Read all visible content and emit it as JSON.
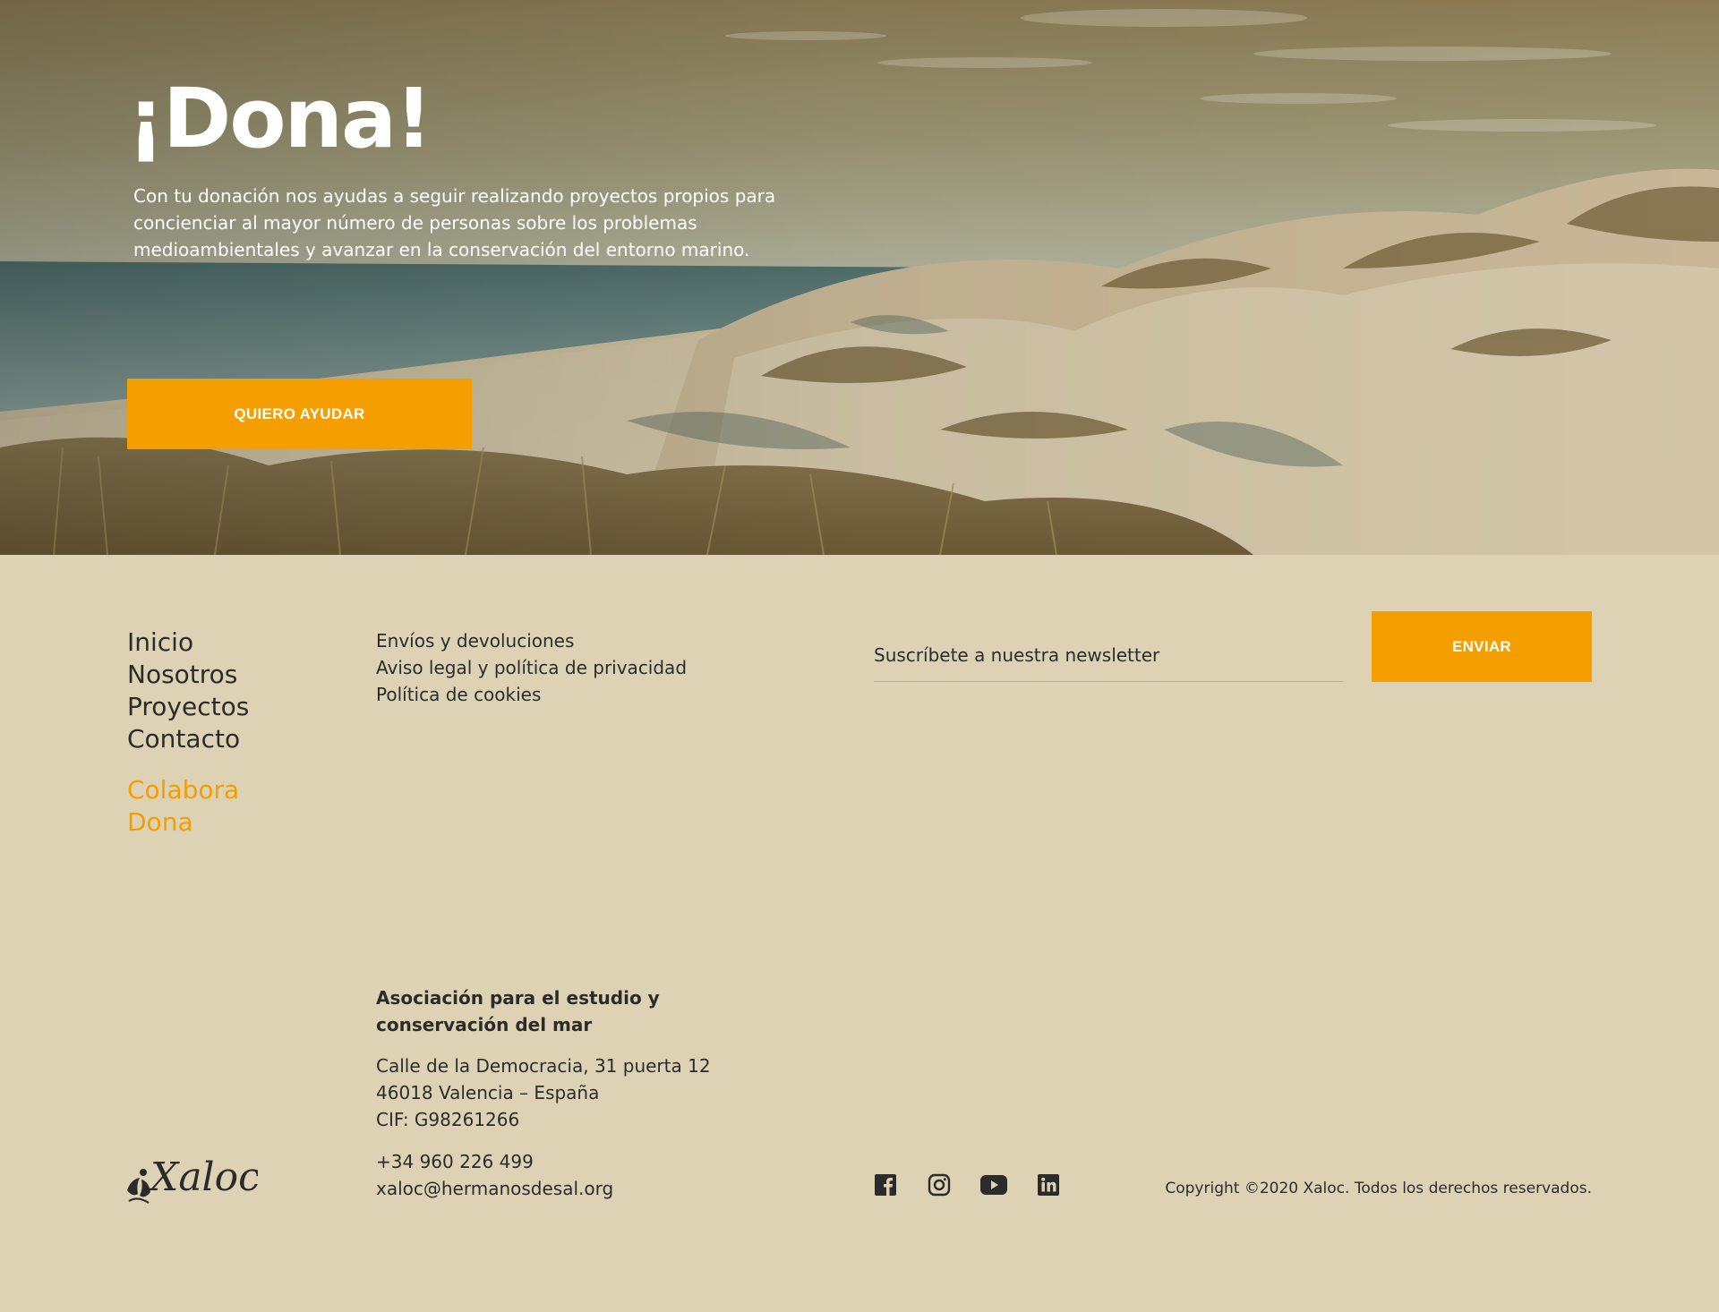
{
  "hero": {
    "title": "¡Dona!",
    "text": "Con tu donación nos ayudas a seguir realizando proyectos propios para concienciar al mayor número de personas sobre los problemas medioambientales y avanzar en la conservación del entorno marino.",
    "cta_label": "QUIERO AYUDAR"
  },
  "footer": {
    "nav_main": [
      "Inicio",
      "Nosotros",
      "Proyectos",
      "Contacto"
    ],
    "nav_accent": [
      "Colabora",
      "Dona"
    ],
    "nav_legal": [
      "Envíos y devoluciones",
      "Aviso legal y política de privacidad",
      "Política de cookies"
    ],
    "newsletter": {
      "placeholder": "Suscríbete a nuestra newsletter",
      "button_label": "ENVIAR"
    },
    "org": {
      "name": "Asociación para el estudio y conservación del mar",
      "address_line1": "Calle de la Democracia, 31 puerta 12",
      "address_line2": "46018 Valencia – España",
      "cif": "CIF: G98261266",
      "phone": "+34 960 226 499",
      "email": "xaloc@hermanosdesal.org"
    },
    "logo_text": "Xaloc",
    "social": [
      "facebook-icon",
      "instagram-icon",
      "youtube-icon",
      "linkedin-icon"
    ],
    "copyright": "Copyright ©2020 Xaloc. Todos los derechos reservados."
  },
  "colors": {
    "accent": "#f59e00",
    "footer_bg": "#ddd3b4",
    "text": "#2b2b2b"
  }
}
